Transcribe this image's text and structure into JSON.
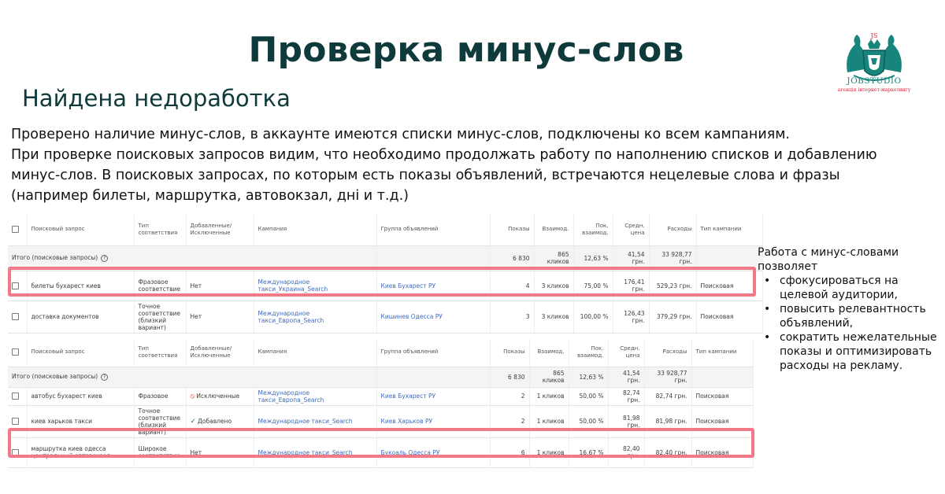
{
  "title": "Проверка минус-слов",
  "subtitle": "Найдена недоработка",
  "intro": [
    "Проверено наличие минус-слов, в аккаунте имеются списки минус-слов, подключены ко всем кампаниям.",
    "При проверке поисковых запросов видим, что необходимо продолжать работу по наполнению списков и добавлению",
    "минус-слов. В поисковых запросах, по которым есть показы объявлений, встречаются нецелевые слова и фразы",
    "(например билеты, маршрутка, автовокзал, дні и т.д.)"
  ],
  "logo": {
    "name": "JOBSTUDIO",
    "tagline": "агенція інтернет-маркетингу",
    "accent": "#17857c"
  },
  "table_headers": [
    "Поисковый запрос",
    "Тип соответствия",
    "Добавленные/ Исключенные",
    "Кампания",
    "Группа объявлений",
    "Показы",
    "Взаимод.",
    "Пок. взаимод.",
    "Средн. цена",
    "Расходы",
    "Тип кампании"
  ],
  "table1": {
    "total": {
      "label": "Итого (поисковые запросы)",
      "shows": "6 830",
      "interactions": "865 кликов",
      "rate": "12,63 %",
      "avg": "41,54 грн.",
      "cost": "33 928,77 грн."
    },
    "rows": [
      {
        "query": "билеты бухарест киев",
        "match": "Фразовое соответствие",
        "added": "Нет",
        "campaign": "Международное такси_Украина_Search",
        "group": "Киев Бухарест РУ",
        "shows": "4",
        "interactions": "3 кликов",
        "rate": "75,00 %",
        "avg": "176,41 грн.",
        "cost": "529,23 грн.",
        "type": "Поисковая"
      },
      {
        "query": "доставка документов",
        "match": "Точное соответствие (близкий вариант)",
        "added": "Нет",
        "campaign": "Международное такси_Европа_Search",
        "group": "Кишинев Одесса РУ",
        "shows": "3",
        "interactions": "3 кликов",
        "rate": "100,00 %",
        "avg": "126,43 грн.",
        "cost": "379,29 грн.",
        "type": "Поисковая"
      }
    ]
  },
  "table2": {
    "total": {
      "label": "Итого (поисковые запросы)",
      "shows": "6 830",
      "interactions": "865 кликов",
      "rate": "12,63 %",
      "avg": "41,54 грн.",
      "cost": "33 928,77 грн."
    },
    "rows": [
      {
        "query": "автобус бухарест киев",
        "match": "Фразовое",
        "added": "Исключенные",
        "added_icon": "ban-icon",
        "campaign": "Международное такси_Европа_Search",
        "group": "Киев Бухарест РУ",
        "shows": "2",
        "interactions": "1 кликов",
        "rate": "50,00 %",
        "avg": "82,74 грн.",
        "cost": "82,74 грн.",
        "type": "Поисковая"
      },
      {
        "query": "киев харьков такси",
        "match": "Точное соответствие (близкий вариант)",
        "added": "Добавлено",
        "added_icon": "check-icon",
        "campaign": "Международное такси_Search",
        "group": "Киев Харьков РУ",
        "shows": "2",
        "interactions": "1 кликов",
        "rate": "50,00 %",
        "avg": "81,98 грн.",
        "cost": "81,98 грн.",
        "type": "Поисковая"
      },
      {
        "query": "маршрутка киев одесса центральный автовокзал",
        "match": "Широкое соответствие",
        "added": "Нет",
        "added_icon": "",
        "campaign": "Международное такси_Search",
        "group": "Букоаль Одесса РУ",
        "shows": "6",
        "interactions": "1 кликов",
        "rate": "16,67 %",
        "avg": "82,40 грн.",
        "cost": "82,40 грн.",
        "type": "Поисковая"
      }
    ]
  },
  "side": {
    "intro": "Работа с минус-словами позволяет",
    "items": [
      "сфокусироваться на целевой аудитории,",
      "повысить релевантность объявлений,",
      "сократить нежелательные показы и оптимизировать расходы на рекламу."
    ]
  },
  "colors": {
    "title": "#0f3a3c",
    "highlight": "#f27a86",
    "link": "#3d6bc0"
  }
}
